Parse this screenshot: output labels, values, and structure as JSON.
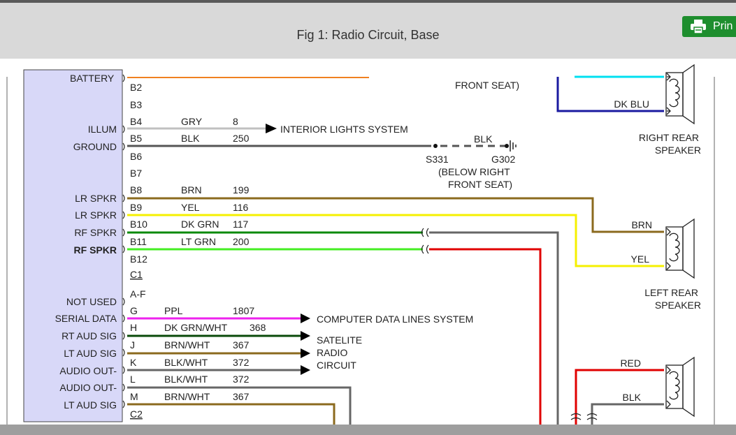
{
  "header": {
    "title": "Fig 1: Radio Circuit, Base",
    "print_label": "Prin"
  },
  "colors": {
    "orange": "#f08020",
    "gray": "#bfbfbf",
    "black": "#555555",
    "brown": "#8b6a1e",
    "yellow": "#f5f000",
    "dkgreen": "#0a8a0a",
    "ltgreen": "#44ee22",
    "magenta": "#ee22ee",
    "red": "#e00000",
    "dkblue": "#1a1aa0",
    "cyan": "#00e0f0"
  },
  "radio_labels": [
    "BATTERY",
    "ILLUM",
    "GROUND",
    "LR SPKR",
    "LR SPKR",
    "RF SPKR",
    "RF SPKR",
    "NOT USED",
    "SERIAL DATA",
    "RT AUD SIG",
    "LT AUD SIG",
    "AUDIO OUT-",
    "AUDIO OUT-",
    "LT AUD SIG"
  ],
  "pins": [
    "B2",
    "B3",
    "B4",
    "B5",
    "B6",
    "B7",
    "B8",
    "B9",
    "B10",
    "B11",
    "B12",
    "C1",
    "A-F",
    "G",
    "H",
    "J",
    "K",
    "L",
    "M",
    "C2"
  ],
  "wires": [
    {
      "color": "GRY",
      "circuit": "8"
    },
    {
      "color": "BLK",
      "circuit": "250"
    },
    {
      "color": "BRN",
      "circuit": "199"
    },
    {
      "color": "YEL",
      "circuit": "116"
    },
    {
      "color": "DK GRN",
      "circuit": "117"
    },
    {
      "color": "LT GRN",
      "circuit": "200"
    },
    {
      "color": "PPL",
      "circuit": "1807"
    },
    {
      "color": "DK GRN/WHT",
      "circuit": "368"
    },
    {
      "color": "BRN/WHT",
      "circuit": "367"
    },
    {
      "color": "BLK/WHT",
      "circuit": "372"
    },
    {
      "color": "BLK/WHT",
      "circuit": "372"
    },
    {
      "color": "BRN/WHT",
      "circuit": "367"
    }
  ],
  "destinations": {
    "interior": "INTERIOR LIGHTS SYSTEM",
    "data_lines": "COMPUTER DATA LINES SYSTEM",
    "satelite": [
      "SATELITE",
      "RADIO",
      "CIRCUIT"
    ]
  },
  "ground": {
    "wire": "BLK",
    "splice": "S331",
    "ground": "G302",
    "note": [
      "(BELOW RIGHT",
      "FRONT SEAT)"
    ]
  },
  "top_note": "FRONT SEAT)",
  "speakers": {
    "right_rear": {
      "wire": "DK BLU",
      "name": [
        "RIGHT REAR",
        "SPEAKER"
      ]
    },
    "left_rear": {
      "wires": [
        "BRN",
        "YEL"
      ],
      "name": [
        "LEFT REAR",
        "SPEAKER"
      ]
    },
    "lower": {
      "wires": [
        "RED",
        "BLK"
      ]
    }
  }
}
